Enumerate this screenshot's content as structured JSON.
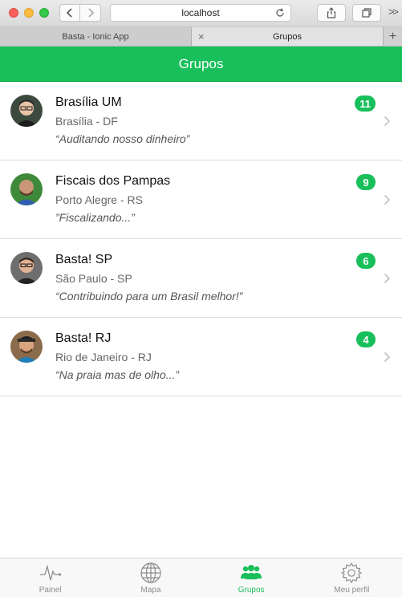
{
  "browser": {
    "url": "localhost",
    "tabs": [
      {
        "label": "Basta - Ionic App",
        "active": false
      },
      {
        "label": "Grupos",
        "active": true
      }
    ]
  },
  "header": {
    "title": "Grupos"
  },
  "groups": [
    {
      "name": "Brasília UM",
      "location": "Brasília - DF",
      "quote": "“Auditando nosso dinheiro”",
      "count": "11"
    },
    {
      "name": "Fiscais dos Pampas",
      "location": "Porto Alegre - RS",
      "quote": "”Fiscalizando...”",
      "count": "9"
    },
    {
      "name": "Basta! SP",
      "location": "São Paulo - SP",
      "quote": "“Contribuindo para um Brasil melhor!”",
      "count": "6"
    },
    {
      "name": "Basta! RJ",
      "location": "Rio de Janeiro - RJ",
      "quote": "“Na praia mas de olho...”",
      "count": "4"
    }
  ],
  "tabbar": [
    {
      "label": "Painel",
      "icon": "pulse-icon",
      "active": false
    },
    {
      "label": "Mapa",
      "icon": "globe-icon",
      "active": false
    },
    {
      "label": "Grupos",
      "icon": "people-icon",
      "active": true
    },
    {
      "label": "Meu perfil",
      "icon": "gear-icon",
      "active": false
    }
  ],
  "colors": {
    "accent": "#18bf5a",
    "badge": "#18bf5a"
  }
}
